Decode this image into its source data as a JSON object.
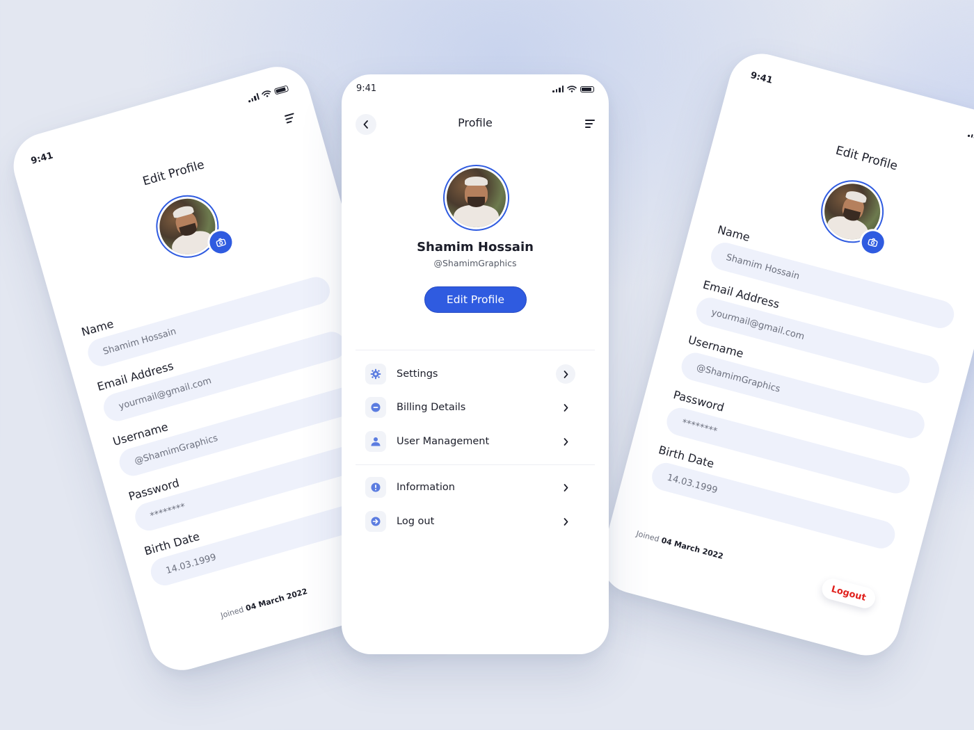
{
  "status_time": "9:41",
  "user": {
    "name": "Shamim Hossain",
    "handle": "@ShamimGraphics"
  },
  "edit_profile": {
    "title": "Edit Profile",
    "fields": [
      {
        "label": "Name",
        "value": "Shamim Hossain"
      },
      {
        "label": "Email Address",
        "value": "yourmail@gmail.com"
      },
      {
        "label": "Username",
        "value": "@ShamimGraphics"
      },
      {
        "label": "Password",
        "value": "********"
      },
      {
        "label": "Birth Date",
        "value": "14.03.1999"
      }
    ],
    "joined_prefix": "Joined",
    "joined_date": "04 March 2022",
    "logout_label": "Logout"
  },
  "profile": {
    "title": "Profile",
    "edit_button_label": "Edit Profile",
    "menu_group_1": [
      {
        "label": "Settings",
        "icon": "gear-icon"
      },
      {
        "label": "Billing Details",
        "icon": "minus-circle-icon"
      },
      {
        "label": "User Management",
        "icon": "user-icon"
      }
    ],
    "menu_group_2": [
      {
        "label": "Information",
        "icon": "info-icon"
      },
      {
        "label": "Log out",
        "icon": "arrow-right-circle-icon"
      }
    ]
  },
  "colors": {
    "accent": "#2f5be0",
    "field_bg": "#eef1fb",
    "logout_text": "#e0201c",
    "background": "#e3e7f1"
  }
}
